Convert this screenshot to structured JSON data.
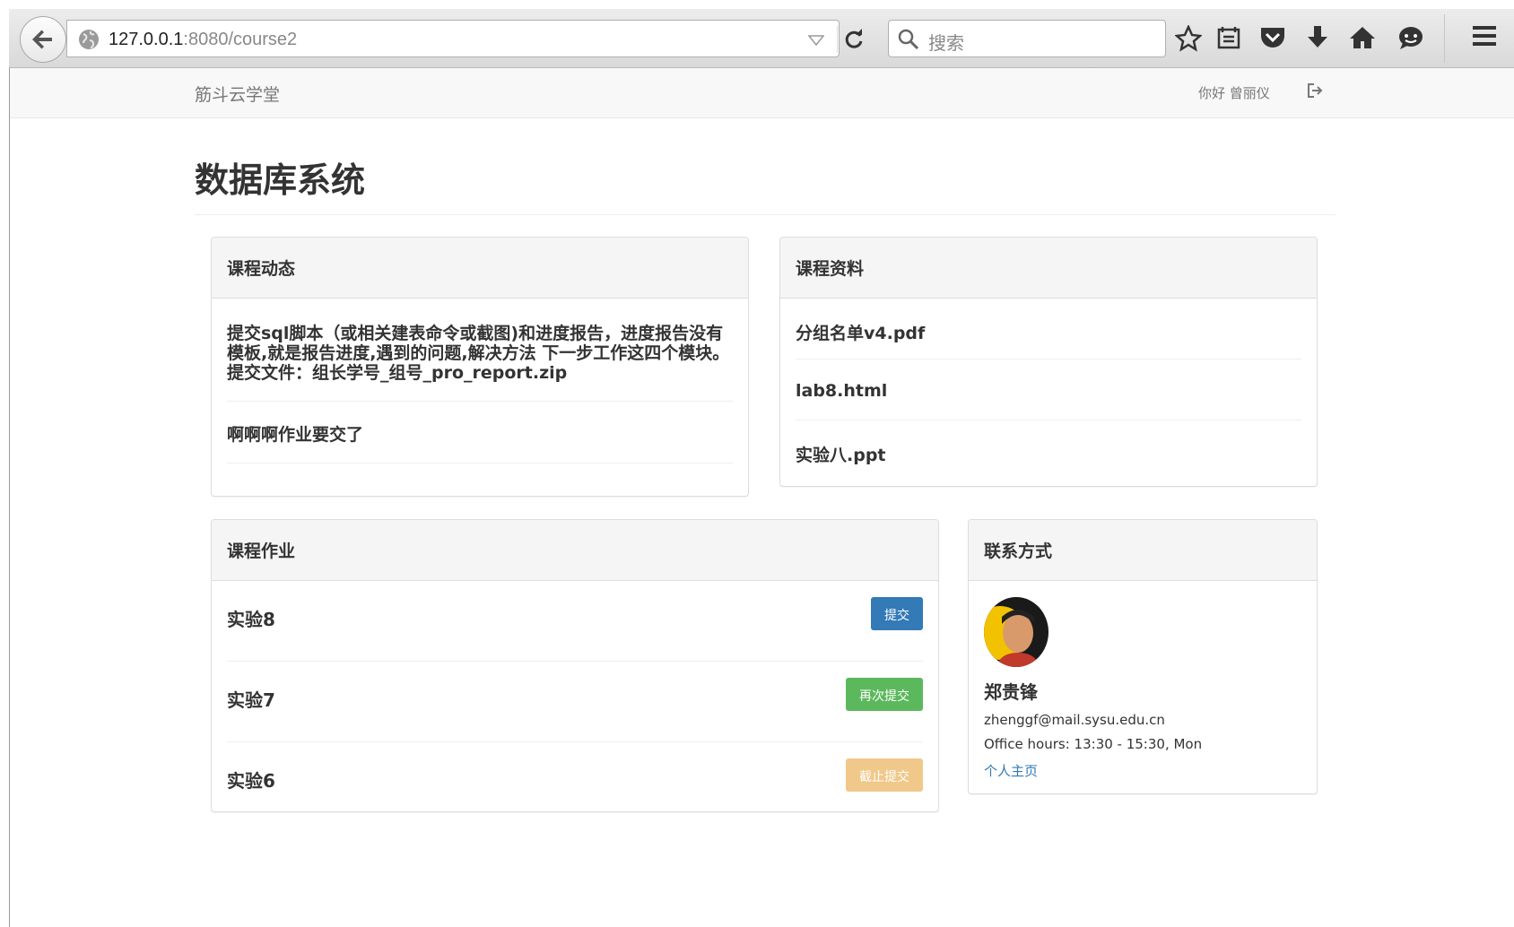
{
  "browser": {
    "url_host": "127.0.0.1",
    "url_path": ":8080/course2",
    "search_placeholder": "搜索"
  },
  "navbar": {
    "brand": "筋斗云学堂",
    "greeting": "你好 曾丽仪"
  },
  "page_title": "数据库系统",
  "news": {
    "heading": "课程动态",
    "items": [
      "提交sql脚本（或相关建表命令或截图)和进度报告，进度报告没有模板,就是报告进度,遇到的问题,解决方法 下一步工作这四个模块。提交文件：组长学号_组号_pro_report.zip",
      "啊啊啊作业要交了"
    ]
  },
  "files": {
    "heading": "课程资料",
    "items": [
      "分组名单v4.pdf",
      "lab8.html",
      "实验八.ppt"
    ]
  },
  "homework": {
    "heading": "课程作业",
    "items": [
      {
        "name": "实验8",
        "action": "提交",
        "color": "#337ab7"
      },
      {
        "name": "实验7",
        "action": "再次提交",
        "color": "#5cb85c"
      },
      {
        "name": "实验6",
        "action": "截止提交",
        "color": "#f0c88a"
      }
    ]
  },
  "contact": {
    "heading": "联系方式",
    "name": "郑贵锋",
    "email": "zhenggf@mail.sysu.edu.cn",
    "office_hours": "Office hours: 13:30 - 15:30, Mon",
    "homepage_link": "个人主页"
  }
}
